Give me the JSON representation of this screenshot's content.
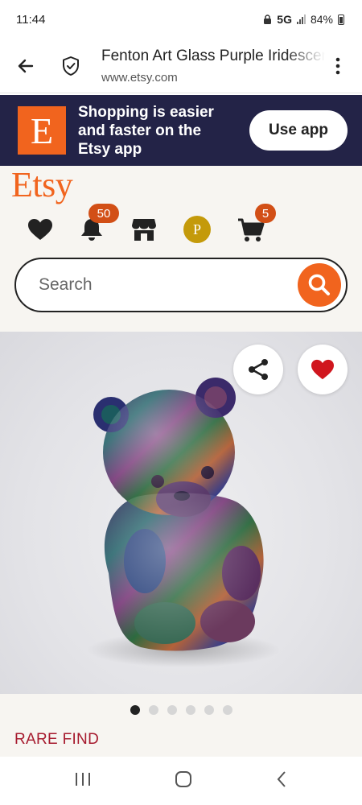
{
  "status_bar": {
    "time": "11:44",
    "network": "5G",
    "battery": "84%"
  },
  "browser": {
    "title": "Fenton Art Glass Purple Iridescent",
    "url": "www.etsy.com"
  },
  "banner": {
    "badge_letter": "E",
    "text": "Shopping is easier and faster on the Etsy app",
    "button_label": "Use app"
  },
  "header": {
    "logo": "Etsy",
    "notifications_count": "50",
    "cart_count": "5",
    "avatar_letter": "P"
  },
  "search": {
    "placeholder": "Search"
  },
  "gallery": {
    "image_count": 6,
    "active_index": 0
  },
  "listing": {
    "badge": "RARE FIND"
  },
  "colors": {
    "brand_orange": "#F1641E",
    "banner_bg": "#232347",
    "badge_red": "#D24F16",
    "rare_find_red": "#A61A2E",
    "favorite_red": "#D0161E",
    "avatar_gold": "#C49A0A"
  }
}
